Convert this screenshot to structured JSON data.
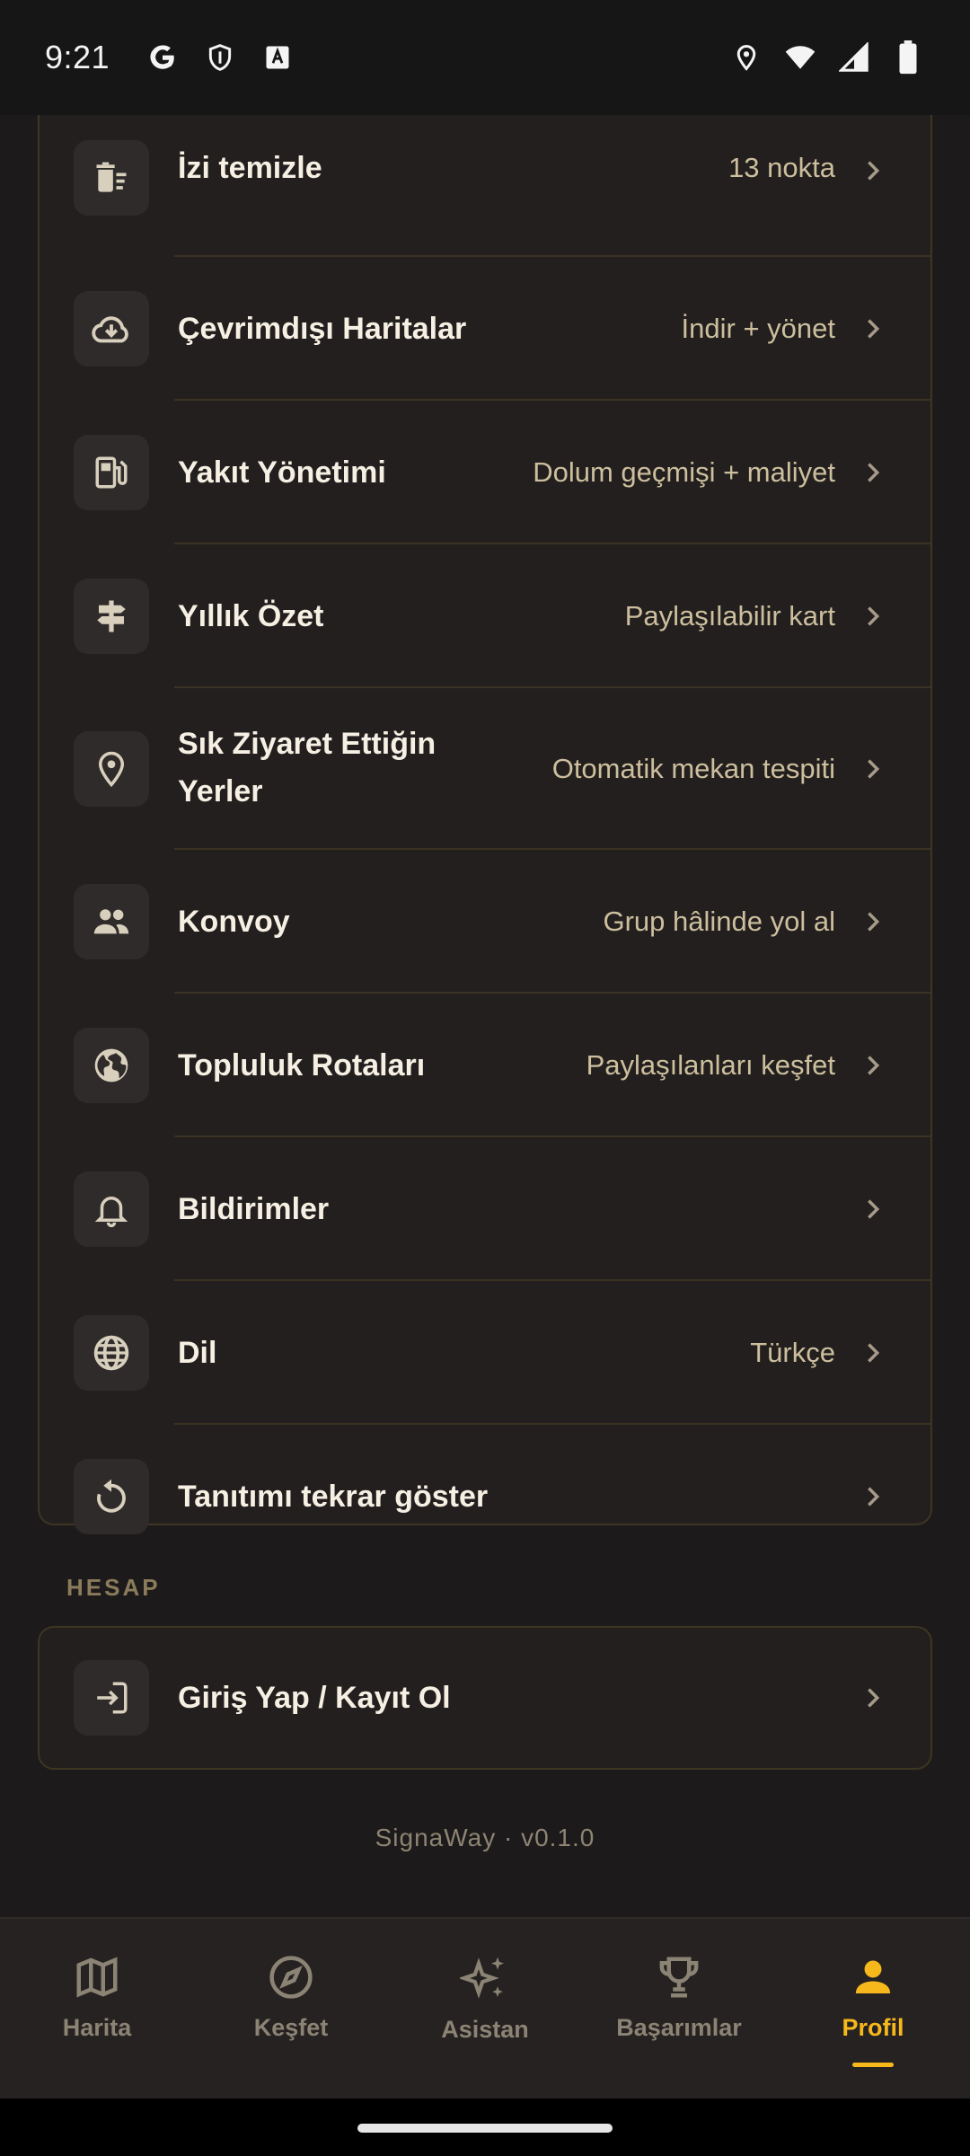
{
  "status_bar": {
    "time": "9:21",
    "left_icons": [
      "google-icon",
      "shield-icon",
      "keyboard-a-icon"
    ],
    "right_icons": [
      "location-icon",
      "wifi-icon",
      "signal-icon",
      "battery-icon"
    ]
  },
  "settings": {
    "items": [
      {
        "icon": "trash-list-icon",
        "title": "İzi temizle",
        "value": "13 nokta"
      },
      {
        "icon": "cloud-download-icon",
        "title": "Çevrimdışı Haritalar",
        "value": "İndir + yönet"
      },
      {
        "icon": "fuel-icon",
        "title": "Yakıt Yönetimi",
        "value": "Dolum geçmişi + maliyet"
      },
      {
        "icon": "signpost-icon",
        "title": "Yıllık Özet",
        "value": "Paylaşılabilir kart"
      },
      {
        "icon": "location-pin-icon",
        "title_line1": "Sık Ziyaret Ettiğin",
        "title_line2": "Yerler",
        "value": "Otomatik mekan tespiti"
      },
      {
        "icon": "group-icon",
        "title": "Konvoy",
        "value": "Grup hâlinde yol al"
      },
      {
        "icon": "public-globe-icon",
        "title": "Topluluk Rotaları",
        "value": "Paylaşılanları keşfet"
      },
      {
        "icon": "bell-icon",
        "title": "Bildirimler",
        "value": ""
      },
      {
        "icon": "language-globe-icon",
        "title": "Dil",
        "value": "Türkçe"
      },
      {
        "icon": "replay-icon",
        "title": "Tanıtımı tekrar göster",
        "value": ""
      }
    ]
  },
  "account": {
    "section_label": "HESAP",
    "login_icon": "login-icon",
    "login_label": "Giriş Yap / Kayıt Ol"
  },
  "footer": {
    "version": "SignaWay · v0.1.0"
  },
  "bottom_nav": {
    "items": [
      {
        "icon": "map-icon",
        "label": "Harita"
      },
      {
        "icon": "compass-icon",
        "label": "Keşfet"
      },
      {
        "icon": "sparkle-icon",
        "label": "Asistan"
      },
      {
        "icon": "trophy-icon",
        "label": "Başarımlar"
      },
      {
        "icon": "person-icon",
        "label": "Profil"
      }
    ],
    "active_index": 4,
    "active_color": "#f7b81c",
    "inactive_color": "#8b8374"
  },
  "colors": {
    "background": "#1c1a1a",
    "card": "#221f1e",
    "card_border": "#3e3622",
    "value_text": "#cdbf9e",
    "accent": "#f7b81c"
  }
}
